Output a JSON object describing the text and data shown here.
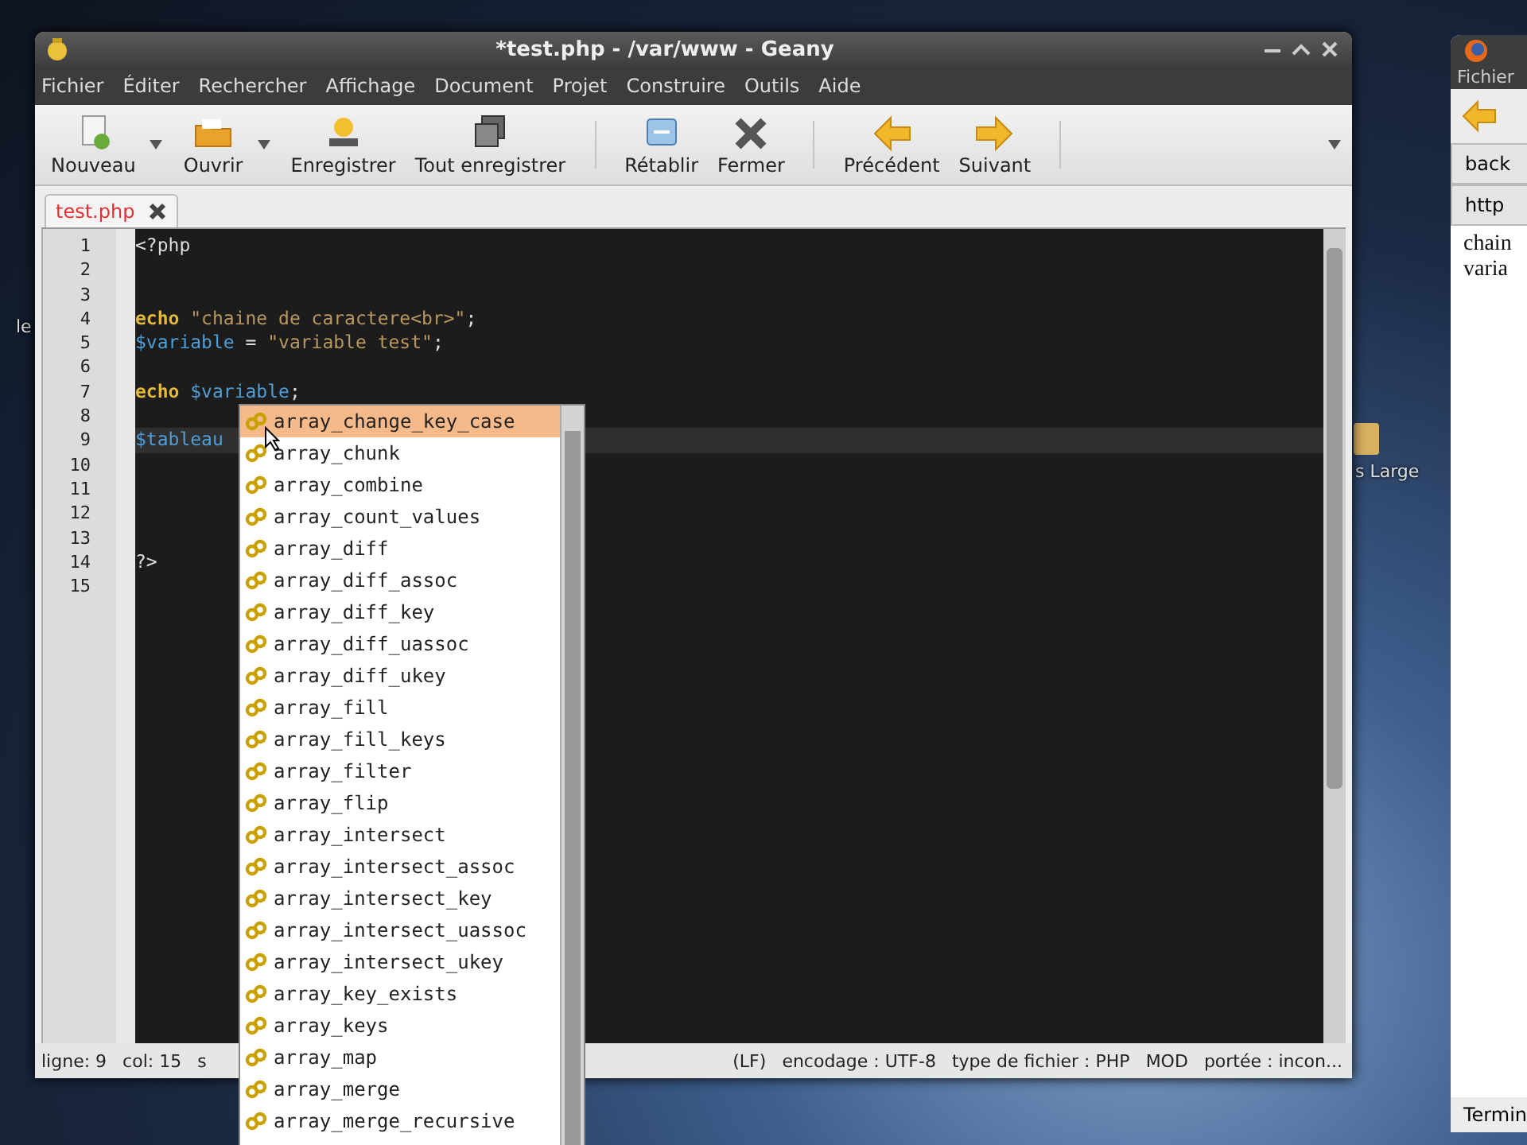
{
  "desktop": {
    "icon_labels": [
      {
        "text": "le"
      },
      {
        "text": "s Large"
      }
    ]
  },
  "window": {
    "title": "*test.php - /var/www - Geany"
  },
  "menu": [
    "Fichier",
    "Éditer",
    "Rechercher",
    "Affichage",
    "Document",
    "Projet",
    "Construire",
    "Outils",
    "Aide"
  ],
  "toolbar": [
    {
      "label": "Nouveau",
      "has_menu": true
    },
    {
      "label": "Ouvrir",
      "has_menu": true
    },
    {
      "label": "Enregistrer",
      "has_menu": false
    },
    {
      "label": "Tout enregistrer",
      "has_menu": false
    },
    {
      "label": "Rétablir",
      "has_menu": false
    },
    {
      "label": "Fermer",
      "has_menu": false
    },
    {
      "label": "Précédent",
      "has_menu": false
    },
    {
      "label": "Suivant",
      "has_menu": false
    }
  ],
  "tabs": [
    {
      "label": "test.php",
      "selected": true,
      "modified": true
    }
  ],
  "editor": {
    "lines": [
      {
        "number": "1",
        "tokens": [
          {
            "kind": "plain",
            "text": "<?php"
          }
        ]
      },
      {
        "number": "2"
      },
      {
        "number": "3"
      },
      {
        "number": "4",
        "tokens": [
          {
            "kind": "keyword",
            "text": "echo"
          },
          {
            "kind": "string",
            "text": " \"chaine de caractere<br>\""
          },
          {
            "kind": "plain",
            "text": ";"
          }
        ]
      },
      {
        "number": "5",
        "tokens": [
          {
            "kind": "variable",
            "text": "$variable"
          },
          {
            "kind": "plain",
            "text": " = "
          },
          {
            "kind": "string",
            "text": "\"variable test\""
          },
          {
            "kind": "plain",
            "text": ";"
          }
        ]
      },
      {
        "number": "6"
      },
      {
        "number": "7",
        "tokens": [
          {
            "kind": "keyword",
            "text": "echo"
          },
          {
            "kind": "variable",
            "text": " $variable"
          },
          {
            "kind": "plain",
            "text": ";"
          }
        ]
      },
      {
        "number": "8"
      },
      {
        "number": "9",
        "current": true,
        "tokens": [
          {
            "kind": "variable",
            "text": "$tableau"
          }
        ]
      },
      {
        "number": "10"
      },
      {
        "number": "11"
      },
      {
        "number": "12"
      },
      {
        "number": "13"
      },
      {
        "number": "14",
        "tokens": [
          {
            "kind": "plain",
            "text": "?>"
          }
        ]
      },
      {
        "number": "15"
      }
    ]
  },
  "autocomplete": [
    {
      "label": "array_change_key_case",
      "selected": true
    },
    {
      "label": "array_chunk",
      "selected": false
    },
    {
      "label": "array_combine",
      "selected": false
    },
    {
      "label": "array_count_values",
      "selected": false
    },
    {
      "label": "array_diff",
      "selected": false
    },
    {
      "label": "array_diff_assoc",
      "selected": false
    },
    {
      "label": "array_diff_key",
      "selected": false
    },
    {
      "label": "array_diff_uassoc",
      "selected": false
    },
    {
      "label": "array_diff_ukey",
      "selected": false
    },
    {
      "label": "array_fill",
      "selected": false
    },
    {
      "label": "array_fill_keys",
      "selected": false
    },
    {
      "label": "array_filter",
      "selected": false
    },
    {
      "label": "array_flip",
      "selected": false
    },
    {
      "label": "array_intersect",
      "selected": false
    },
    {
      "label": "array_intersect_assoc",
      "selected": false
    },
    {
      "label": "array_intersect_key",
      "selected": false
    },
    {
      "label": "array_intersect_uassoc",
      "selected": false
    },
    {
      "label": "array_intersect_ukey",
      "selected": false
    },
    {
      "label": "array_key_exists",
      "selected": false
    },
    {
      "label": "array_keys",
      "selected": false
    },
    {
      "label": "array_map",
      "selected": false
    },
    {
      "label": "array_merge",
      "selected": false
    },
    {
      "label": "array_merge_recursive",
      "selected": false
    }
  ],
  "status_bar": {
    "left": [
      "ligne: 9",
      "col: 15",
      "s"
    ],
    "right": [
      "(LF)",
      "encodage : UTF-8",
      "type de fichier : PHP",
      "MOD",
      "portée : incon..."
    ]
  },
  "browser": {
    "menu": "Fichier",
    "tab": "back",
    "address": "http",
    "content": [
      "chain",
      "varia"
    ],
    "status": "Termin"
  }
}
